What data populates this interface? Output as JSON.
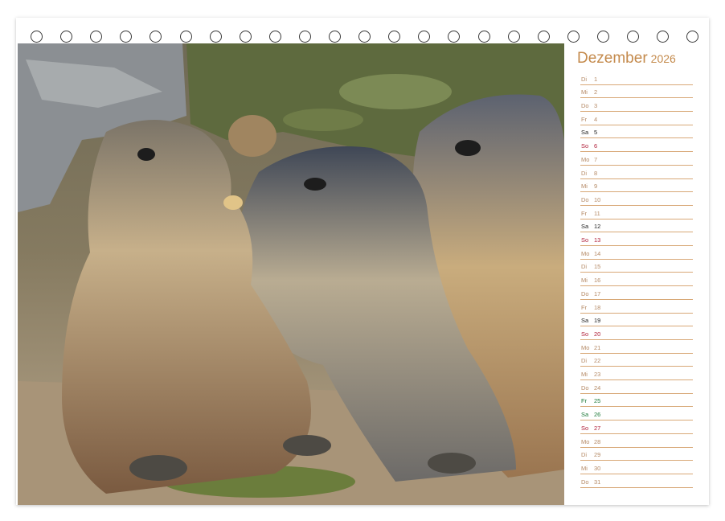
{
  "calendar": {
    "month": "Dezember",
    "year": "2026",
    "days": [
      {
        "weekday": "Di",
        "day": "1",
        "type": "weekday"
      },
      {
        "weekday": "Mi",
        "day": "2",
        "type": "weekday"
      },
      {
        "weekday": "Do",
        "day": "3",
        "type": "weekday"
      },
      {
        "weekday": "Fr",
        "day": "4",
        "type": "weekday"
      },
      {
        "weekday": "Sa",
        "day": "5",
        "type": "saturday"
      },
      {
        "weekday": "So",
        "day": "6",
        "type": "sunday"
      },
      {
        "weekday": "Mo",
        "day": "7",
        "type": "weekday"
      },
      {
        "weekday": "Di",
        "day": "8",
        "type": "weekday"
      },
      {
        "weekday": "Mi",
        "day": "9",
        "type": "weekday"
      },
      {
        "weekday": "Do",
        "day": "10",
        "type": "weekday"
      },
      {
        "weekday": "Fr",
        "day": "11",
        "type": "weekday"
      },
      {
        "weekday": "Sa",
        "day": "12",
        "type": "saturday"
      },
      {
        "weekday": "So",
        "day": "13",
        "type": "sunday"
      },
      {
        "weekday": "Mo",
        "day": "14",
        "type": "weekday"
      },
      {
        "weekday": "Di",
        "day": "15",
        "type": "weekday"
      },
      {
        "weekday": "Mi",
        "day": "16",
        "type": "weekday"
      },
      {
        "weekday": "Do",
        "day": "17",
        "type": "weekday"
      },
      {
        "weekday": "Fr",
        "day": "18",
        "type": "weekday"
      },
      {
        "weekday": "Sa",
        "day": "19",
        "type": "saturday"
      },
      {
        "weekday": "So",
        "day": "20",
        "type": "sunday"
      },
      {
        "weekday": "Mo",
        "day": "21",
        "type": "weekday"
      },
      {
        "weekday": "Di",
        "day": "22",
        "type": "weekday"
      },
      {
        "weekday": "Mi",
        "day": "23",
        "type": "weekday"
      },
      {
        "weekday": "Do",
        "day": "24",
        "type": "weekday"
      },
      {
        "weekday": "Fr",
        "day": "25",
        "type": "holiday"
      },
      {
        "weekday": "Sa",
        "day": "26",
        "type": "holiday"
      },
      {
        "weekday": "So",
        "day": "27",
        "type": "sunday"
      },
      {
        "weekday": "Mo",
        "day": "28",
        "type": "weekday"
      },
      {
        "weekday": "Di",
        "day": "29",
        "type": "weekday"
      },
      {
        "weekday": "Mi",
        "day": "30",
        "type": "weekday"
      },
      {
        "weekday": "Do",
        "day": "31",
        "type": "weekday"
      }
    ]
  },
  "colors": {
    "title": "#c48a4c",
    "weekday_text": "#b58a66",
    "saturday_text": "#222222",
    "sunday_text": "#b0203a",
    "holiday_text": "#1f7a3a",
    "rule": "#d8a877"
  },
  "binding": {
    "ring_count": 23,
    "icon": "spiral-ring-icon"
  }
}
